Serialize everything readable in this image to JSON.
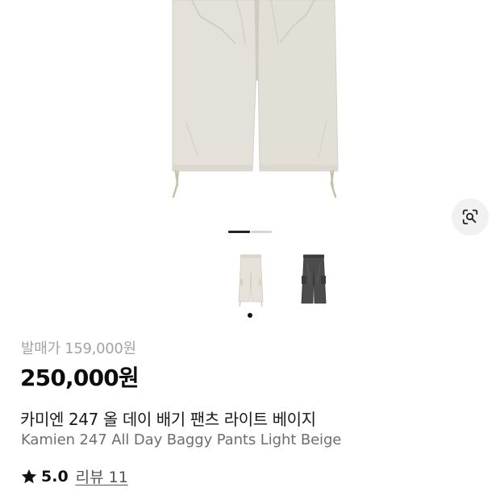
{
  "product": {
    "original_price": "발매가 159,000원",
    "price": "250,000원",
    "title_ko": "카미엔 247 올 데이 배기 팬츠 라이트 베이지",
    "title_en": "Kamien 247 All Day Baggy Pants Light Beige",
    "rating": "5.0",
    "review_link": "리뷰 11"
  },
  "gallery": {
    "current_index": 1,
    "total_images": 2,
    "thumbnails": [
      {
        "color_name": "light-beige",
        "selected": true
      },
      {
        "color_name": "charcoal",
        "selected": false
      }
    ]
  },
  "icons": {
    "lens": "lens-search-icon",
    "star": "star-icon"
  },
  "colors": {
    "beige": "#e4e0d8",
    "charcoal": "#4a4a4a",
    "indicator_active": "#222222",
    "indicator_inactive": "#d6d6d6"
  }
}
